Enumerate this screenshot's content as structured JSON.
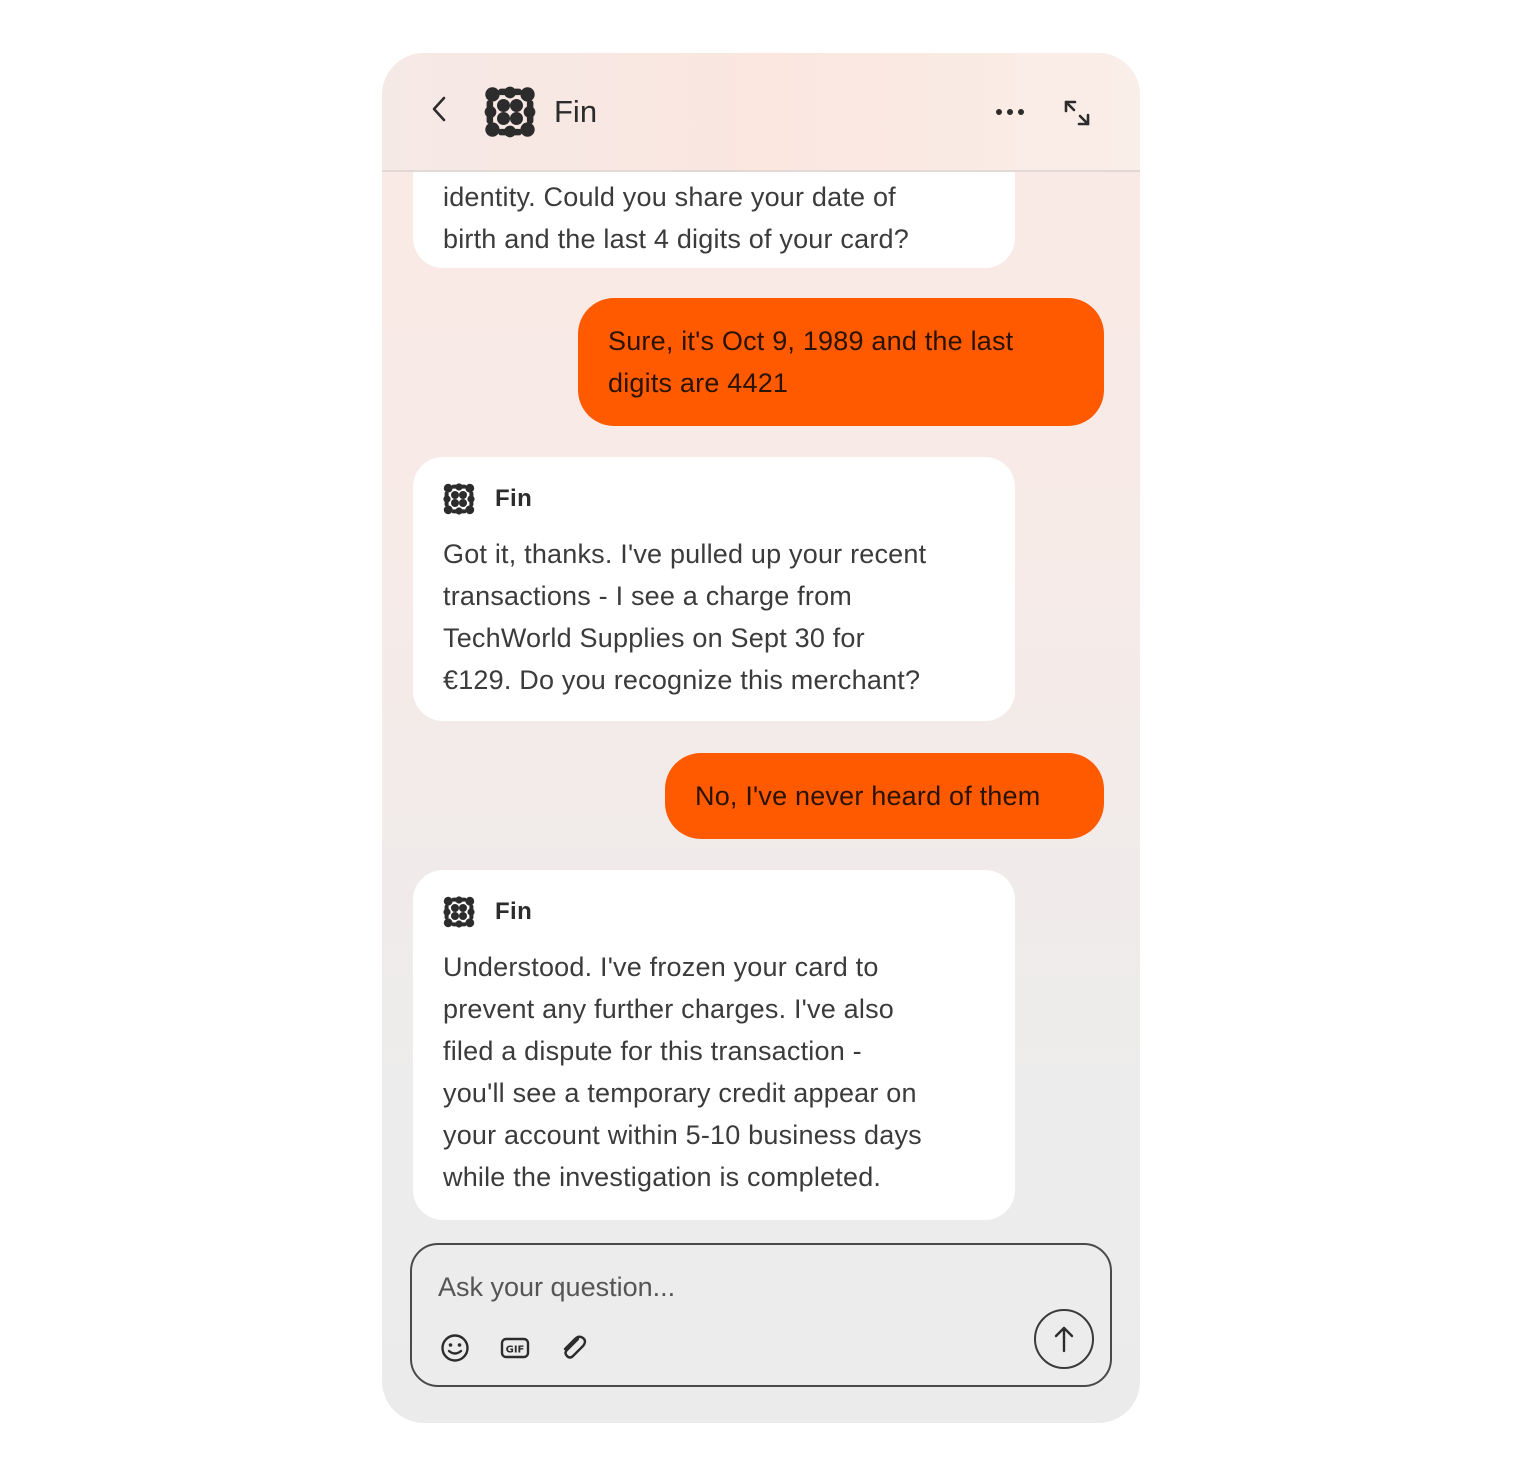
{
  "header": {
    "title": "Fin",
    "back_icon": "chevron-left-icon",
    "more_icon": "more-horizontal-icon",
    "expand_icon": "expand-icon"
  },
  "colors": {
    "user_bubble": "#ff5a00",
    "bot_bubble": "#ffffff",
    "icon_dark": "#2c2c2c"
  },
  "messages": [
    {
      "role": "bot",
      "author": "",
      "lines": [
        "identity. Could you share your date of",
        "birth and the last 4 digits of your card?"
      ]
    },
    {
      "role": "user",
      "lines": [
        "Sure, it's Oct 9, 1989 and the last",
        "digits are 4421"
      ]
    },
    {
      "role": "bot",
      "author": "Fin",
      "lines": [
        "Got it, thanks. I've pulled up your recent",
        "transactions - I see a charge from",
        "TechWorld Supplies on Sept 30 for",
        "€129. Do you recognize this merchant?"
      ]
    },
    {
      "role": "user",
      "lines": [
        "No, I've never heard of them"
      ]
    },
    {
      "role": "bot",
      "author": "Fin",
      "lines": [
        "Understood. I've frozen your card to",
        "prevent any further charges. I've also",
        "filed a dispute for this transaction -",
        "you'll see a temporary credit appear on",
        "your account within 5-10 business days",
        "while the investigation is completed."
      ]
    }
  ],
  "composer": {
    "placeholder": "Ask your question...",
    "tools": [
      "emoji-icon",
      "gif-icon",
      "paperclip-icon"
    ],
    "send_icon": "arrow-up-icon"
  }
}
